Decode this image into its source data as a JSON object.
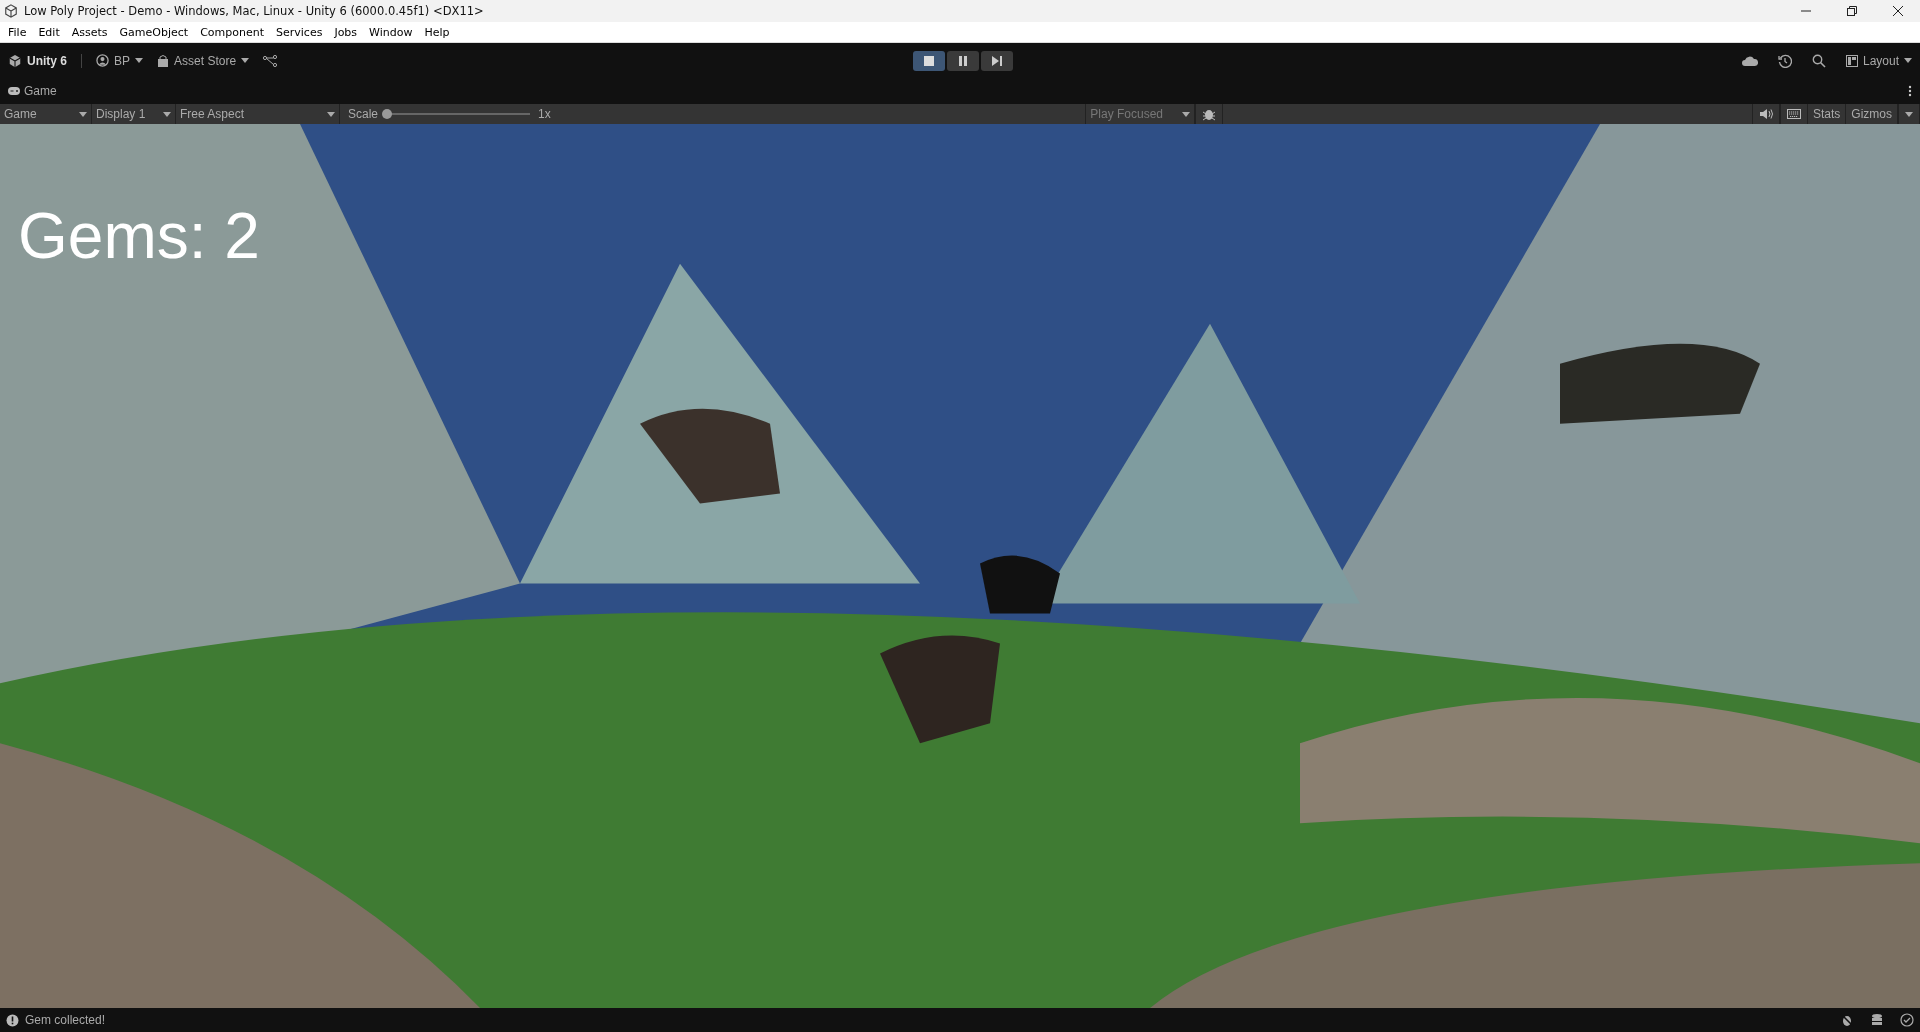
{
  "window": {
    "title": "Low Poly Project - Demo - Windows, Mac, Linux - Unity 6 (6000.0.45f1) <DX11>"
  },
  "menu": [
    "File",
    "Edit",
    "Assets",
    "GameObject",
    "Component",
    "Services",
    "Jobs",
    "Window",
    "Help"
  ],
  "toolbar": {
    "product": "Unity 6",
    "account": "BP",
    "store": "Asset Store",
    "layout": "Layout"
  },
  "playback": [
    {
      "kind": "stop",
      "selected": true
    },
    {
      "kind": "pause",
      "selected": false
    },
    {
      "kind": "step",
      "selected": false
    }
  ],
  "tab": {
    "label": "Game"
  },
  "game_toolbar": {
    "view": "Game",
    "display": "Display 1",
    "aspect": "Free Aspect",
    "scale_label": "Scale",
    "scale": {
      "level": 0.0
    },
    "scale_value": "1x",
    "play_mode": "Play Focused",
    "stats": "Stats",
    "gizmos": "Gizmos"
  },
  "hud": {
    "text": "Gems: 2"
  },
  "status_bar": {
    "message": "Gem collected!"
  }
}
